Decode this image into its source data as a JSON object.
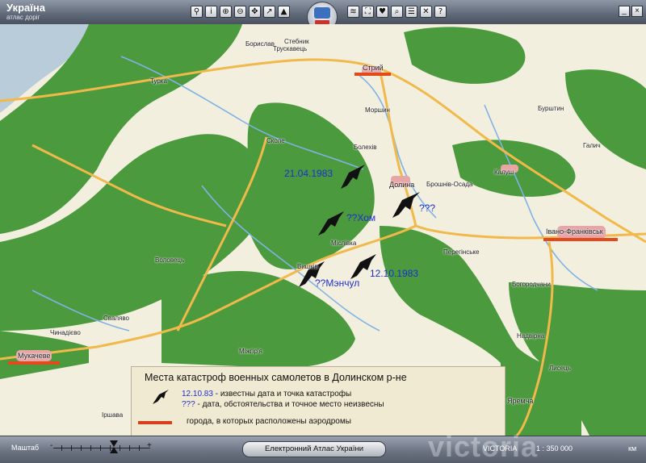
{
  "app": {
    "title": "Україна",
    "subtitle": "атлас доріг"
  },
  "toolbar": {
    "left_icons": [
      "binoculars-icon",
      "info-icon",
      "zoom-in-icon",
      "zoom-out-icon",
      "pan-icon",
      "route-icon",
      "north-icon"
    ],
    "right_icons": [
      "layers-icon",
      "fullscreen-icon",
      "heart-icon",
      "search-icon",
      "list-icon",
      "tools-icon",
      "help-icon"
    ]
  },
  "map": {
    "colors": {
      "land": "#f3efde",
      "forest": "#4b9a3e",
      "road": "#f0b94a",
      "river": "#7fb2e6",
      "water": "#b9ccd9",
      "airfield": "#e24a1c"
    },
    "cities": [
      "Стрий",
      "Івано-Франківськ",
      "Мукачеве"
    ],
    "places": [
      "Борислав",
      "Стебник",
      "Трускавець",
      "Турка",
      "Моршин",
      "Болехів",
      "Долина",
      "Сколе",
      "Брошнів-Осада",
      "Калуш",
      "Бурштин",
      "Галич",
      "Міслівка",
      "Вишків",
      "Перегінське",
      "Богородчани",
      "Воловець",
      "Сваляво",
      "Чинадієво",
      "Міжгір'я",
      "Надвірна",
      "Яремча",
      "Іршава",
      "Лисець"
    ],
    "crashes": [
      {
        "label": "21.04.1983"
      },
      {
        "label": "???"
      },
      {
        "label": "??Хом"
      },
      {
        "label": "12.10.1983"
      },
      {
        "label": "??Мэнчул"
      }
    ]
  },
  "legend": {
    "title": "Места катастроф военных самолетов в Долинском р-не",
    "row1_date": "12.10.83",
    "row1_text": " - известны дата и точка катастрофы",
    "row2_q": "???",
    "row2_text": " - дата, обстоятельства и точное место неизвесны",
    "row3_text": "города, в которых расположены аэродромы"
  },
  "status": {
    "scale_label": "Маштаб",
    "atlas_label": "Електронний Атлас України",
    "brand": "VICTORIA",
    "scale_value": "1 : 350 000",
    "unit": "км",
    "watermark": "victoria"
  }
}
